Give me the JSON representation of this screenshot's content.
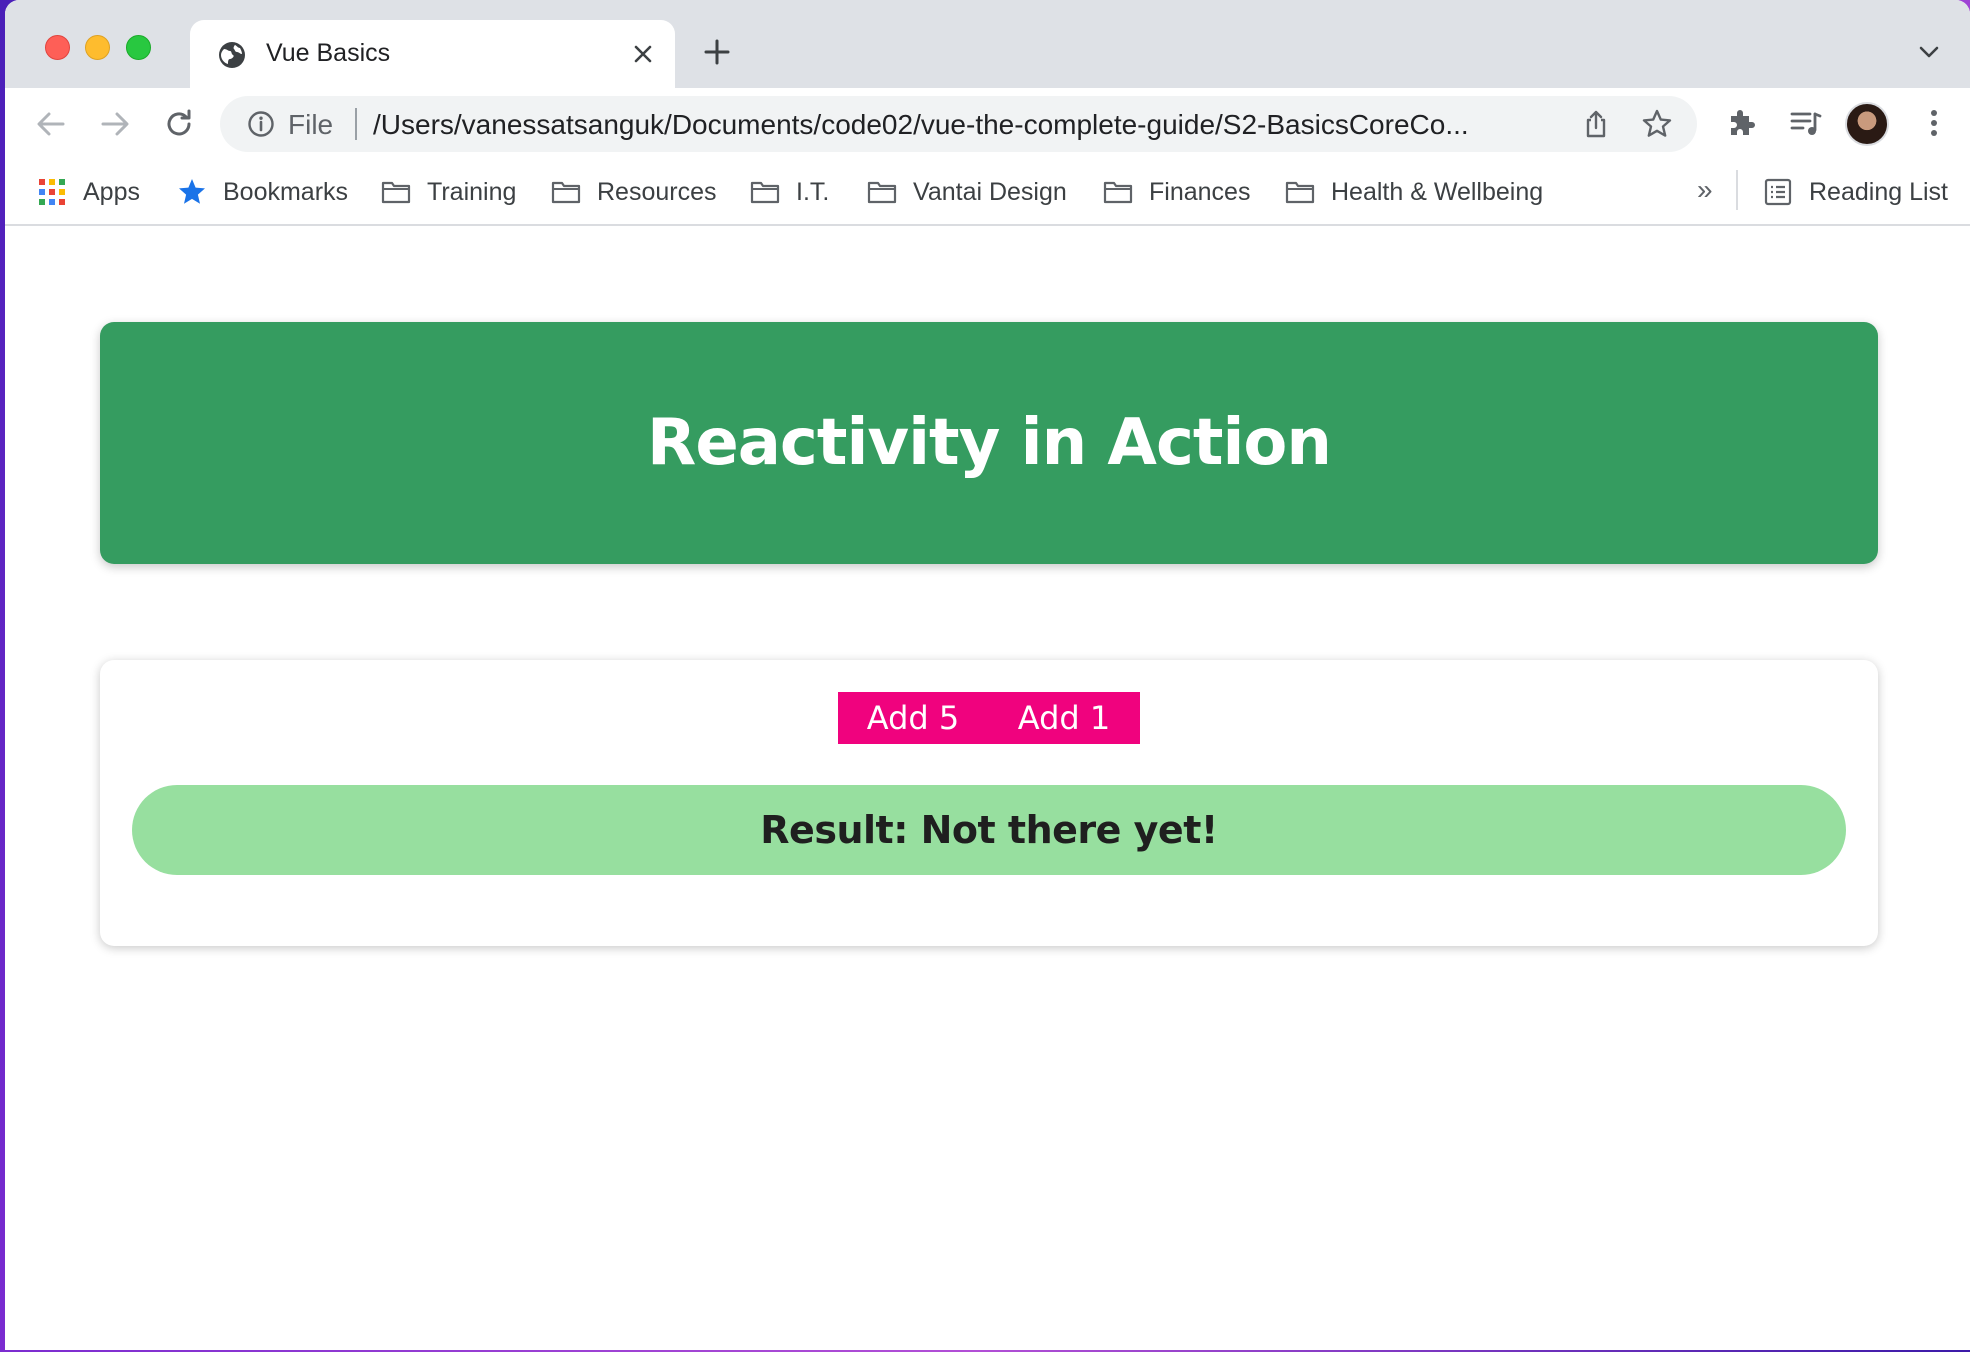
{
  "browser": {
    "tab": {
      "title": "Vue Basics"
    },
    "omnibox": {
      "scheme_label": "File",
      "url": "/Users/vanessatsanguk/Documents/code02/vue-the-complete-guide/S2-BasicsCoreCo..."
    },
    "bookmarks": [
      {
        "label": "Apps",
        "icon": "apps-grid-icon"
      },
      {
        "label": "Bookmarks",
        "icon": "star-icon"
      },
      {
        "label": "Training",
        "icon": "folder-icon"
      },
      {
        "label": "Resources",
        "icon": "folder-icon"
      },
      {
        "label": "I.T.",
        "icon": "folder-icon"
      },
      {
        "label": "Vantai Design",
        "icon": "folder-icon"
      },
      {
        "label": "Finances",
        "icon": "folder-icon"
      },
      {
        "label": "Health & Wellbeing",
        "icon": "folder-icon"
      }
    ],
    "bookmarks_overflow": "»",
    "reading_list": "Reading List"
  },
  "app": {
    "header_title": "Reactivity in Action",
    "buttons": {
      "add5": "Add 5",
      "add1": "Add 1"
    },
    "result": "Result: Not there yet!"
  },
  "colors": {
    "header_green": "#359c60",
    "button_pink": "#f0027e",
    "result_green": "#97df9f"
  }
}
